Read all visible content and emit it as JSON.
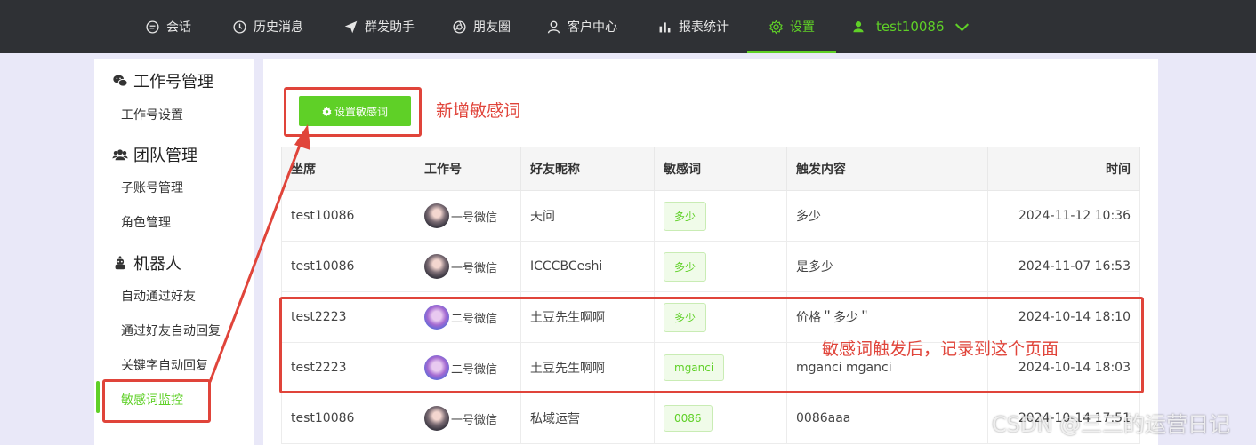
{
  "nav": {
    "items": [
      {
        "label": "会话",
        "icon": "chat-icon"
      },
      {
        "label": "历史消息",
        "icon": "clock-icon"
      },
      {
        "label": "群发助手",
        "icon": "send-icon"
      },
      {
        "label": "朋友圈",
        "icon": "aperture-icon"
      },
      {
        "label": "客户中心",
        "icon": "user-icon"
      },
      {
        "label": "报表统计",
        "icon": "bar-chart-icon"
      },
      {
        "label": "设置",
        "icon": "gear-icon"
      }
    ],
    "active": "设置",
    "user": "test10086",
    "accent": "#5fd027"
  },
  "sidebar": {
    "groups": [
      {
        "label": "工作号管理",
        "icon": "wechat-icon",
        "items": [
          "工作号设置"
        ]
      },
      {
        "label": "团队管理",
        "icon": "team-icon",
        "items": [
          "子账号管理",
          "角色管理"
        ]
      },
      {
        "label": "机器人",
        "icon": "robot-icon",
        "items": [
          "自动通过好友",
          "通过好友自动回复",
          "关键字自动回复",
          "敏感词监控"
        ]
      }
    ],
    "active_item": "敏感词监控"
  },
  "main": {
    "set_button": "设置敏感词",
    "columns": [
      "坐席",
      "工作号",
      "好友昵称",
      "敏感词",
      "触发内容",
      "时间"
    ],
    "rows": [
      {
        "seat": "test10086",
        "account": "一号微信",
        "avatar": "landscape",
        "nickname": "天问",
        "word": "多少",
        "content": "多少",
        "time": "2024-11-12 10:36"
      },
      {
        "seat": "test10086",
        "account": "一号微信",
        "avatar": "landscape",
        "nickname": "ICCCBCeshi",
        "word": "多少",
        "content": "是多少",
        "time": "2024-11-07 16:53"
      },
      {
        "seat": "test2223",
        "account": "二号微信",
        "avatar": "anime",
        "nickname": "土豆先生啊啊",
        "word": "多少",
        "content": "价格＂多少＂",
        "time": "2024-10-14 18:10"
      },
      {
        "seat": "test2223",
        "account": "二号微信",
        "avatar": "anime",
        "nickname": "土豆先生啊啊",
        "word": "mganci",
        "content": "mganci mganci",
        "time": "2024-10-14 18:03"
      },
      {
        "seat": "test10086",
        "account": "一号微信",
        "avatar": "landscape",
        "nickname": "私域运营",
        "word": "0086",
        "content": "0086aaa",
        "time": "2024-10-14 17:51"
      }
    ]
  },
  "annotations": {
    "add_label": "新增敏感词",
    "record_label": "敏感词触发后，记录到这个页面",
    "color": "#e0443a"
  },
  "watermark": "CSDN @三三的运营日记"
}
